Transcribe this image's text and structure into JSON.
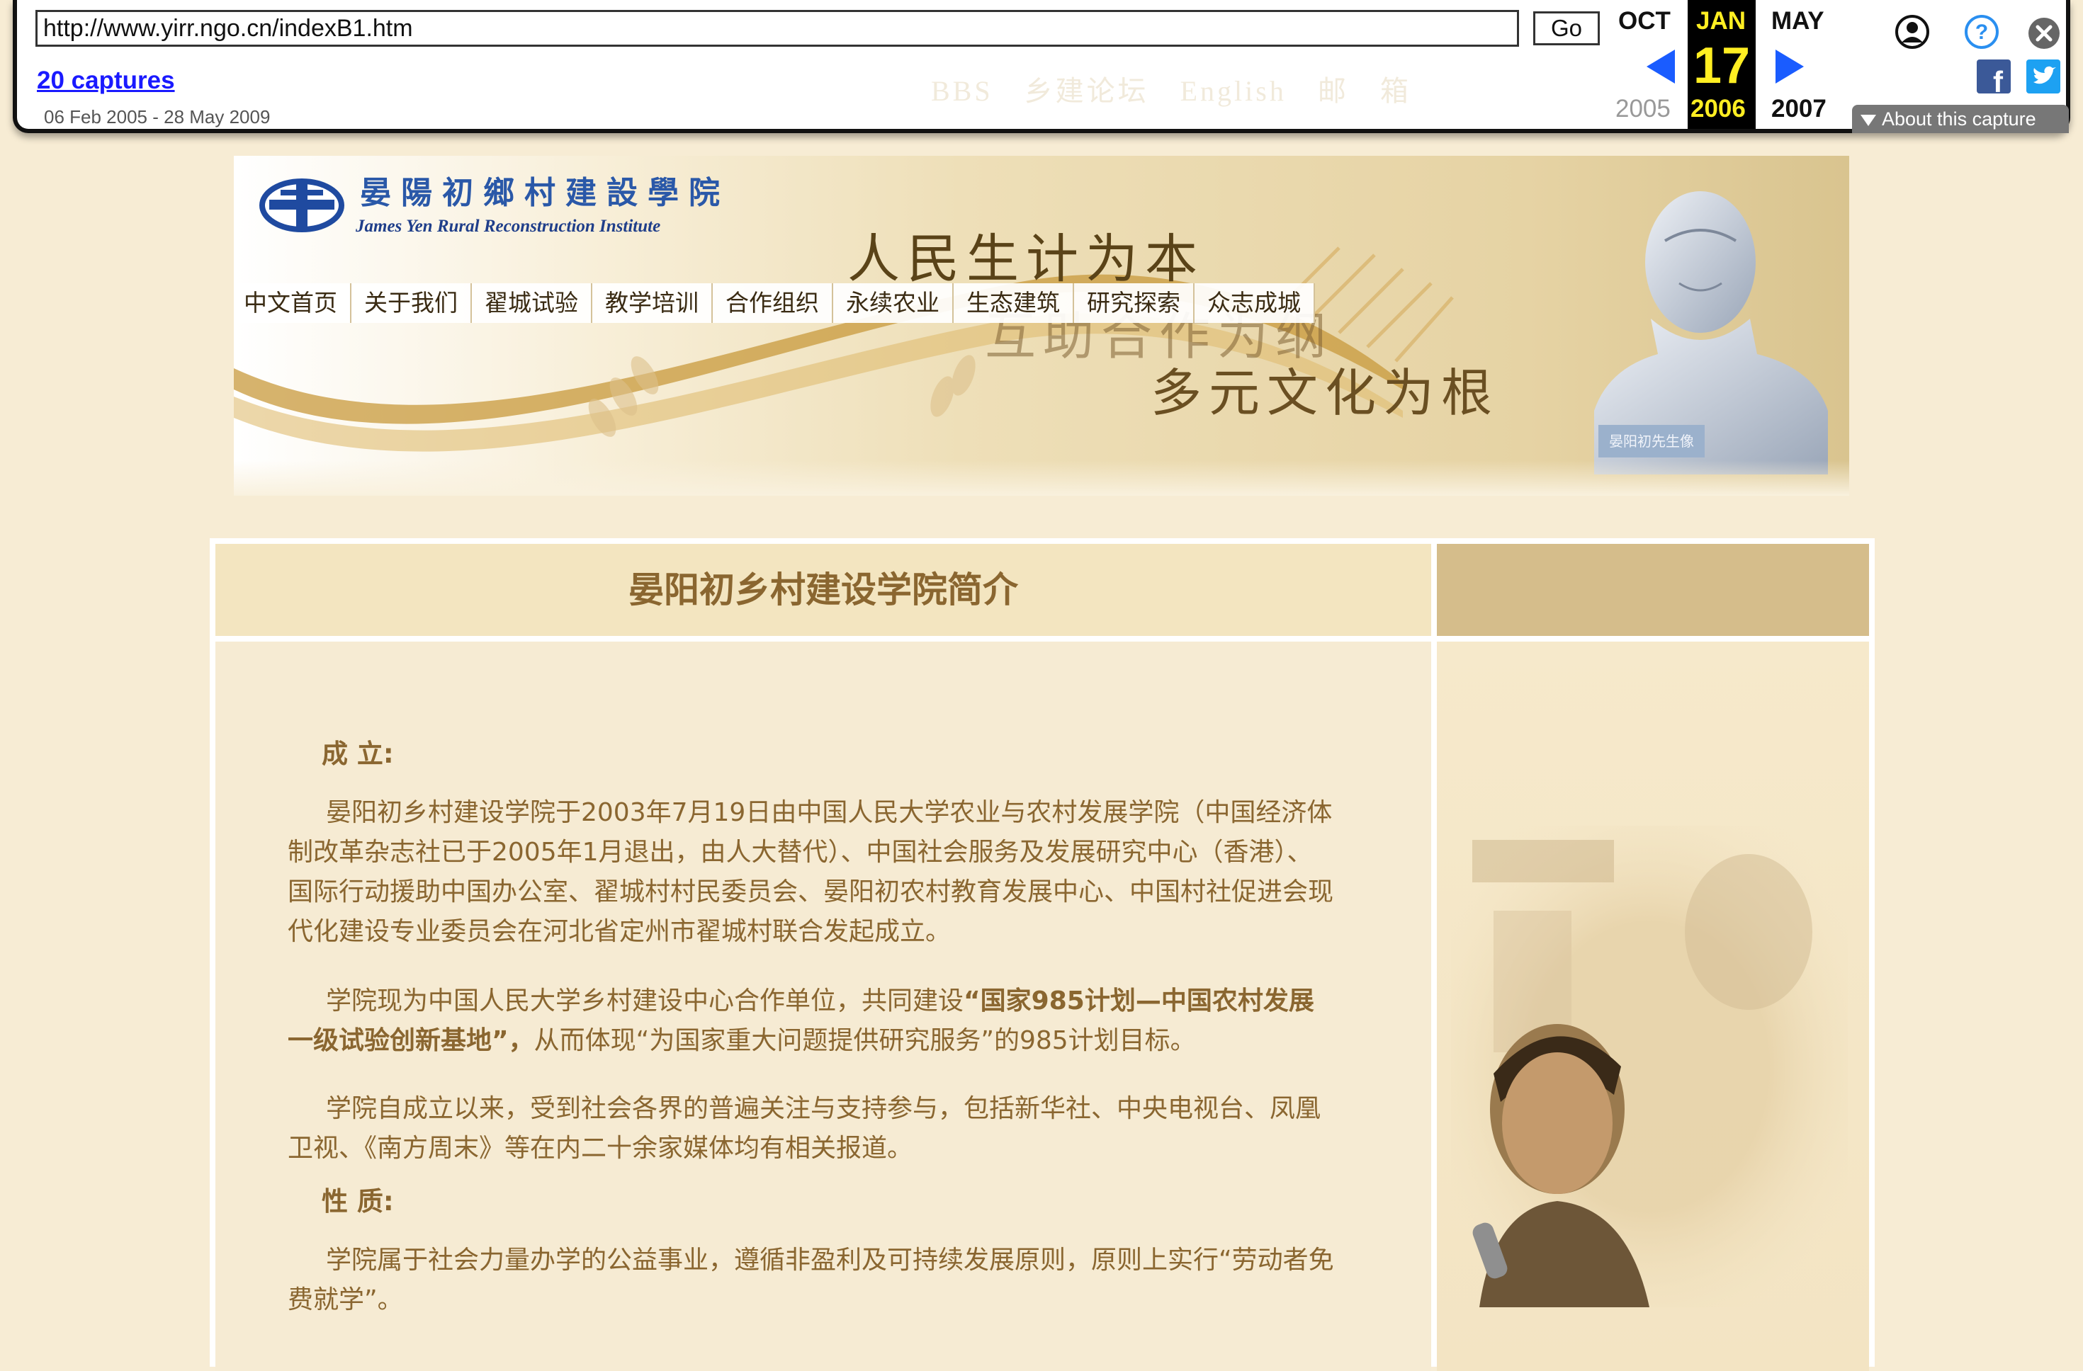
{
  "toolbar": {
    "url": "http://www.yirr.ngo.cn/indexB1.htm",
    "go_label": "Go",
    "captures_label": "20 captures",
    "capture_range": "06 Feb 2005 - 28 May 2009",
    "prev_month": "OCT",
    "current_month": "JAN",
    "next_month": "MAY",
    "current_day": "17",
    "prev_year": "2005",
    "current_year": "2006",
    "next_year": "2007",
    "about_label": "About this capture",
    "ghost_links": [
      "BBS",
      "乡建论坛",
      "English",
      "邮",
      "箱"
    ]
  },
  "banner": {
    "institute_cn": "晏陽初鄉村建設學院",
    "institute_en": "James Yen Rural Reconstruction Institute",
    "slogan_1": "人民生计为本",
    "slogan_2": "互助合作为纲",
    "slogan_3": "多元文化为根",
    "bust_caption": "晏阳初先生像"
  },
  "nav": {
    "items": [
      {
        "label": "中文首页"
      },
      {
        "label": "关于我们"
      },
      {
        "label": "翟城试验"
      },
      {
        "label": "教学培训"
      },
      {
        "label": "合作组织"
      },
      {
        "label": "永续农业"
      },
      {
        "label": "生态建筑"
      },
      {
        "label": "研究探索"
      },
      {
        "label": "众志成城"
      }
    ]
  },
  "content": {
    "title": "晏阳初乡村建设学院简介",
    "heading_1": "成 立:",
    "para_1": "晏阳初乡村建设学院于2003年7月19日由中国人民大学农业与农村发展学院（中国经济体制改革杂志社已于2005年1月退出，由人大替代）、中国社会服务及发展研究中心（香港）、国际行动援助中国办公室、翟城村村民委员会、晏阳初农村教育发展中心、中国村社促进会现代化建设专业委员会在河北省定州市翟城村联合发起成立。",
    "para_2_pre": "学院现为中国人民大学乡村建设中心合作单位，共同建设",
    "para_2_bold": "“国家985计划—中国农村发展一级试验创新基地”，",
    "para_2_post": "从而体现“为国家重大问题提供研究服务”的985计划目标。",
    "para_3": "学院自成立以来，受到社会各界的普遍关注与支持参与，包括新华社、中央电视台、凤凰卫视、《南方周末》等在内二十余家媒体均有相关报道。",
    "heading_2": "性 质:",
    "para_4": "学院属于社会力量办学的公益事业，遵循非盈利及可持续发展原则，原则上实行“劳动者免费就学”。"
  },
  "colors": {
    "page_bg": "#f7ecd4",
    "text_brown": "#8a6630",
    "wayback_blue": "#1a5cff",
    "wayback_yellow": "#ffee22"
  }
}
